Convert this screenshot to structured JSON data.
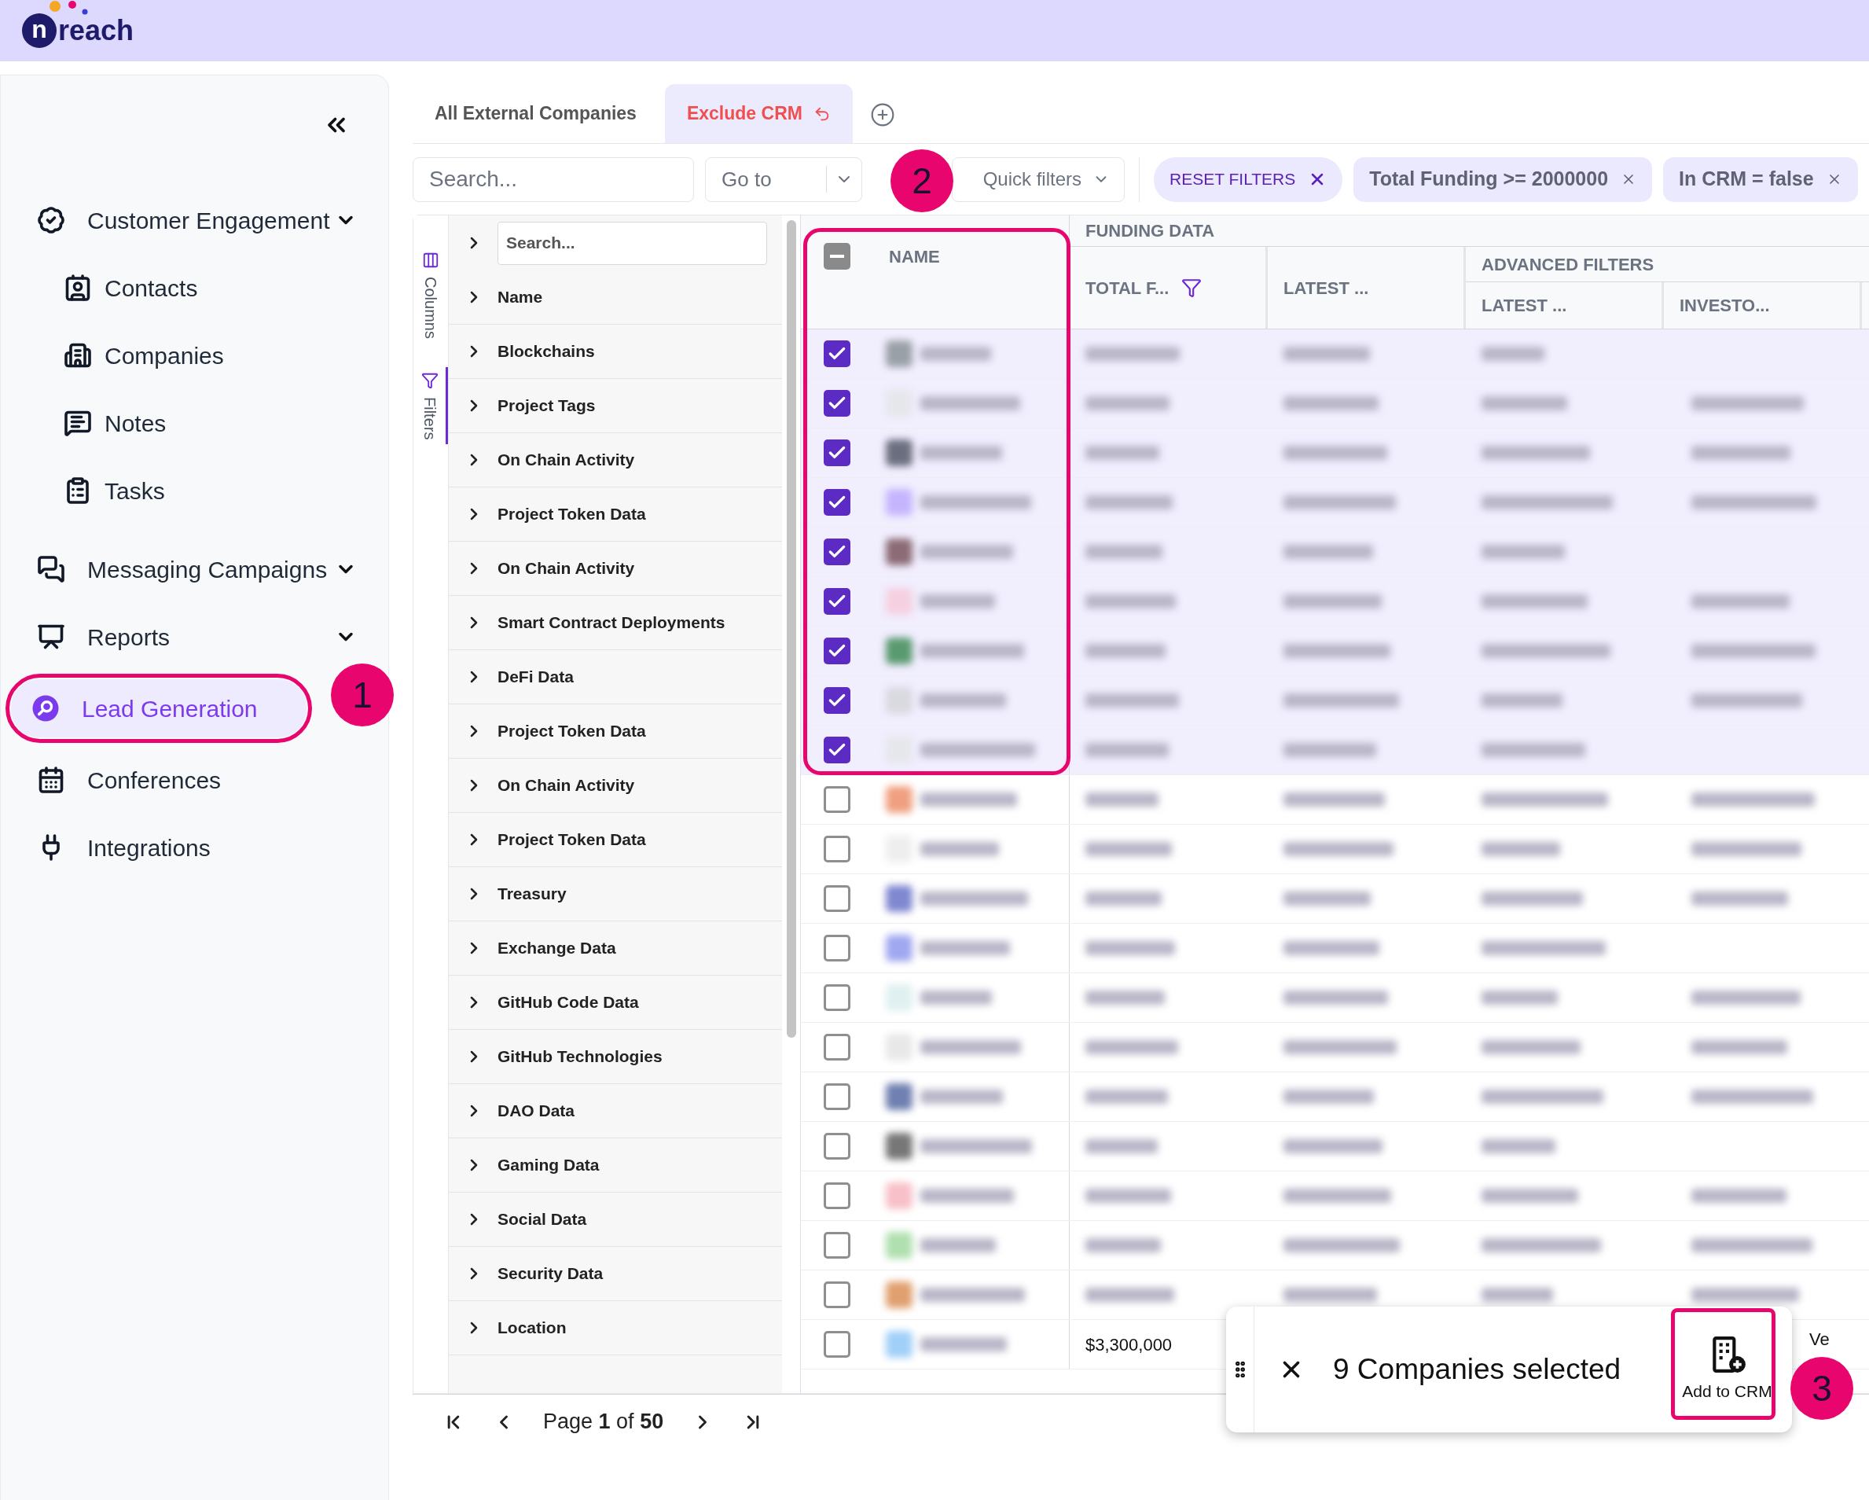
{
  "logo": {
    "badge_letter": "n",
    "wordmark": "reach"
  },
  "sidebar": {
    "items": [
      {
        "label": "Customer Engagement",
        "kind": "group",
        "selected": false,
        "children": [
          {
            "label": "Contacts",
            "selected": false
          },
          {
            "label": "Companies",
            "selected": false
          },
          {
            "label": "Notes",
            "selected": false
          },
          {
            "label": "Tasks",
            "selected": false
          }
        ]
      },
      {
        "label": "Messaging Campaigns",
        "kind": "group",
        "selected": false
      },
      {
        "label": "Reports",
        "kind": "group",
        "selected": false
      },
      {
        "label": "Lead Generation",
        "selected": true
      },
      {
        "label": "Conferences",
        "selected": false
      },
      {
        "label": "Integrations",
        "selected": false
      }
    ]
  },
  "tabs": [
    {
      "label": "All External Companies",
      "selected": false
    },
    {
      "label": "Exclude CRM",
      "selected": true
    }
  ],
  "toolbar": {
    "search": {
      "placeholder": "Search..."
    },
    "go_to": {
      "placeholder": "Go to"
    },
    "quick_filters": {
      "label": "Quick filters"
    },
    "filter_chips": [
      {
        "label": "RESET FILTERS",
        "kind": "reset"
      },
      {
        "label": "Total Funding >= 2000000",
        "kind": "filter"
      },
      {
        "label": "In CRM = false",
        "kind": "filter"
      }
    ]
  },
  "side_tabs": [
    {
      "label": "Columns",
      "selected": false
    },
    {
      "label": "Filters",
      "selected": true
    }
  ],
  "column_panel": {
    "search": {
      "placeholder": "Search..."
    },
    "groups": [
      {
        "label": "Name"
      },
      {
        "label": "Blockchains"
      },
      {
        "label": "Project Tags"
      },
      {
        "label": "On Chain Activity"
      },
      {
        "label": "Project Token Data"
      },
      {
        "label": "On Chain Activity"
      },
      {
        "label": "Smart Contract Deployments"
      },
      {
        "label": "DeFi Data"
      },
      {
        "label": "Project Token Data"
      },
      {
        "label": "On Chain Activity"
      },
      {
        "label": "Project Token Data"
      },
      {
        "label": "Treasury"
      },
      {
        "label": "Exchange Data"
      },
      {
        "label": "GitHub Code Data"
      },
      {
        "label": "GitHub Technologies"
      },
      {
        "label": "DAO Data"
      },
      {
        "label": "Gaming Data"
      },
      {
        "label": "Social Data"
      },
      {
        "label": "Security Data"
      },
      {
        "label": "Location"
      }
    ]
  },
  "grid": {
    "group_headers": [
      {
        "label": "FUNDING DATA"
      },
      {
        "label": "ADVANCED FILTERS"
      }
    ],
    "select_all": {
      "indeterminate": true
    },
    "columns": [
      {
        "label": "NAME",
        "filtered": false
      },
      {
        "label": "TOTAL F...",
        "filtered": true
      },
      {
        "label": "LATEST ...",
        "filtered": false
      },
      {
        "label": "LATEST ...",
        "filtered": false
      },
      {
        "label": "INVESTO...",
        "filtered": false
      }
    ],
    "rows": [
      {
        "checked": true
      },
      {
        "checked": true
      },
      {
        "checked": true
      },
      {
        "checked": true
      },
      {
        "checked": true
      },
      {
        "checked": true
      },
      {
        "checked": true
      },
      {
        "checked": true
      },
      {
        "checked": true
      },
      {
        "checked": false
      },
      {
        "checked": false
      },
      {
        "checked": false
      },
      {
        "checked": false
      },
      {
        "checked": false
      },
      {
        "checked": false
      },
      {
        "checked": false
      },
      {
        "checked": false
      },
      {
        "checked": false
      },
      {
        "checked": false
      },
      {
        "checked": false
      },
      {
        "checked": false,
        "total_funding": "$3,300,000",
        "investors": "Ve"
      }
    ]
  },
  "pagination": {
    "label": "Page **1** of **50**"
  },
  "selection_bar": {
    "message": "9 Companies selected",
    "action": "Add to CRM"
  },
  "annotations": [
    {
      "label": "1"
    },
    {
      "label": "2"
    },
    {
      "label": "3"
    }
  ]
}
